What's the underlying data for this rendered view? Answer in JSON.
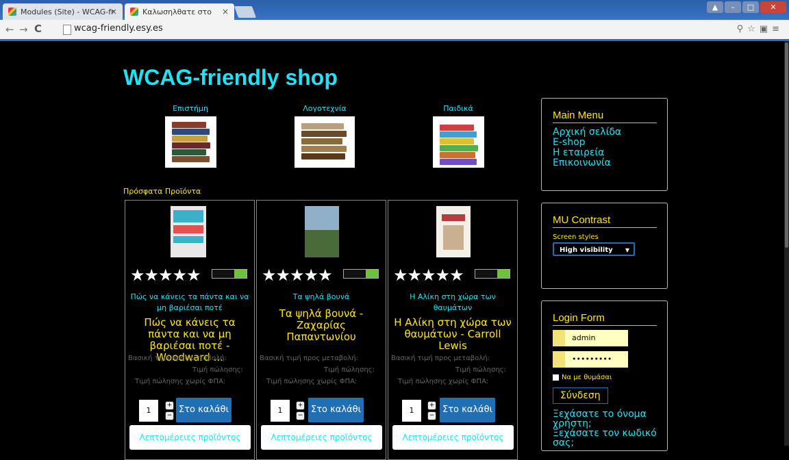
{
  "browser": {
    "tabs": [
      {
        "title": "Modules (Site) - WCAG-fr"
      },
      {
        "title": "Καλωσηλθατε στο"
      }
    ],
    "url": "wcag-friendly.esy.es"
  },
  "site": {
    "title": "WCAG-friendly shop",
    "categories": [
      {
        "label": "Επιστήμη"
      },
      {
        "label": "Λογοτεχνία"
      },
      {
        "label": "Παιδικά"
      }
    ],
    "recent_title": "Πρόσφατα Προϊόντα",
    "products": [
      {
        "short_title": "Πώς να κάνεις τα πάντα και να μη βαριέσαι ποτέ",
        "full_title": "Πώς να κάνεις τα πάντα και να μη βαριέσαι ποτέ - Woodward ...",
        "stars": "★★★★★",
        "price_label_1": "Βασική τιμή προς μεταβολή:",
        "price_label_2": "Τιμή πώλησης:",
        "price_label_3": "Τιμή πώλησης χωρίς ΦΠΑ:",
        "qty": "1",
        "cart_label": "Στο καλάθι",
        "details_label": "Λεπτομέρειες προϊόντος"
      },
      {
        "short_title": "Τα ψηλά βουνά",
        "full_title": "Τα ψηλά βουνά - Ζαχαρίας Παπαντωνίου",
        "stars": "★★★★★",
        "price_label_1": "Βασική τιμή προς μεταβολή:",
        "price_label_2": "Τιμή πώλησης:",
        "price_label_3": "Τιμή πώλησης χωρίς ΦΠΑ:",
        "qty": "1",
        "cart_label": "Στο καλάθι",
        "details_label": "Λεπτομέρειες προϊόντος"
      },
      {
        "short_title": "Η Αλίκη στη χώρα των θαυμάτων",
        "full_title": "Η Αλίκη στη χώρα των θαυμάτων - Carroll Lewis",
        "stars": "★★★★★",
        "price_label_1": "Βασική τιμή προς μεταβολή:",
        "price_label_2": "Τιμή πώλησης:",
        "price_label_3": "Τιμή πώλησης χωρίς ΦΠΑ:",
        "qty": "1",
        "cart_label": "Στο καλάθι",
        "details_label": "Λεπτομέρειες προϊόντος"
      }
    ]
  },
  "sidebar": {
    "main_menu": {
      "title": "Main Menu",
      "items": [
        "Αρχική σελίδα",
        "E-shop",
        "Η εταιρεία",
        "Επικοινωνία"
      ]
    },
    "contrast": {
      "title": "MU Contrast",
      "label": "Screen styles",
      "selected": "High visibility"
    },
    "login": {
      "title": "Login Form",
      "username": "admin",
      "password": "•••••••••",
      "remember": "Να με θυμάσαι",
      "submit": "Σύνδεση",
      "forgot_user": "Ξεχάσατε το όνομα χρήστη;",
      "forgot_pass": "Ξεχάσατε τον κωδικό σας;"
    }
  },
  "colors": {
    "accent_cyan": "#1ee3f5",
    "accent_yellow": "#ffe800",
    "button_blue": "#1f6fb2"
  }
}
